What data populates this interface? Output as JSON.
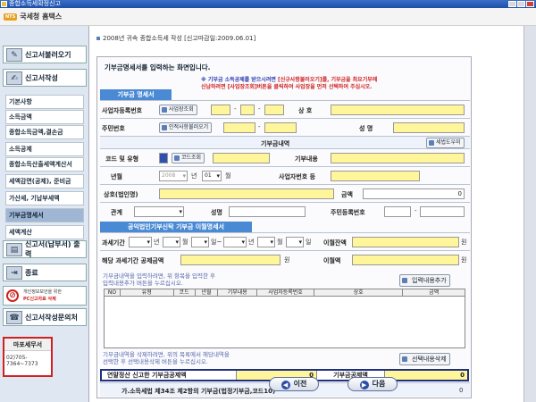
{
  "window": {
    "title": "종합소득세확정신고"
  },
  "banner": {
    "logo_badge": "NTS",
    "logo_text": "국세청 홈택스"
  },
  "sidebar": {
    "top_button": "신고서불러오기",
    "write_button": "신고서작성",
    "items": [
      "기본사항",
      "소득금액",
      "종합소득금액,결손금",
      "소득공제",
      "종합소득산출세액계산서",
      "세액감면(공제), 준비금",
      "가산세, 기납부세액",
      "기부금명세서",
      "세액계산"
    ],
    "submit_button": "신고서(납부서) 출력",
    "end_button": "종료",
    "privacy_line1": "개인정보보안을 위한",
    "privacy_line2": "PC신고자료 삭제",
    "inquiry_button": "신고서작성문의처",
    "office": {
      "name": "마포세무서",
      "phone": "02)705-7364~7373"
    }
  },
  "main": {
    "header": "2008년 귀속 종합소득세 작성 [신고마감일:2009.06.01]",
    "panel_title": "기부금명세서를 입력하는 화면입니다.",
    "note_1a": "※ 기부금 소득공제를 받으시려면 ",
    "note_1b": "[신규사항불러오기]",
    "note_1c": "를, 기부금을 최요기부에",
    "note_2a": "신납하려면 [사업장조회]",
    "note_2b": "버튼을 클릭하여 사업장을 먼저 선택하여 주십시오.",
    "sec1": "기부금 명세서",
    "bizno_label": "사업자등록번호",
    "biz_lookup_btn": "사업장조회",
    "dash": "-",
    "name_label": "상  호",
    "jumin_label": "주민번호",
    "person_lookup_btn": "인적사항불러오기",
    "fullname_label": "성   명",
    "sub_sec": "기부금내역",
    "help_btn": "세법도우미",
    "code_label": "코드 및 유형",
    "code_lookup_btn": "코드조회",
    "desc_label": "기부내용",
    "year_label": "년월",
    "year_val": "2008",
    "year_unit": "년",
    "month_val": "01",
    "month_unit": "월",
    "biz_no_label": "사업자번호 등",
    "org_label": "상호(법인명)",
    "amount_label": "금액",
    "amount_val": "0",
    "relation_label": "관계",
    "name2_label": "성명",
    "rrn_label": "주민등록번호",
    "sec2": "공익법인기부신탁 기부금 이월명세서",
    "period_label": "과세기간",
    "y_unit": "년",
    "m_unit": "월",
    "d_unit": "일",
    "tilde": "일~",
    "carry_bal_label": "이월잔액",
    "won": "원",
    "deduct_label": "해당 과세기간 공제금액",
    "carry_label": "이월액",
    "add_note1": "기부금내역을 입력하려면, 위 항목을 입력한 후",
    "add_note2": "입력내용추가 버튼을 누르십시오.",
    "add_btn": "입력내용추가",
    "table_headers": [
      "NO",
      "유형",
      "코드",
      "년월",
      "기부내용",
      "사업자등록번호",
      "상호",
      "금액"
    ],
    "del_note1": "기부금내역을 삭제하려면, 위의 목록에서 해당내역을",
    "del_note2": "선택한 후 선택내용삭제 버튼을 누르십시오.",
    "del_btn": "선택내용삭제",
    "sum_label1": "연말정산 신고한 기부금공제액",
    "sum_val1": "0",
    "sum_label2": "기부금공제액",
    "sum_val2": "0",
    "law_label": "가.소득세법 제34조 제2항의 기부금(법정기부금,코드10)",
    "law_val": "0",
    "prev_btn": "이전",
    "next_btn": "다음"
  }
}
